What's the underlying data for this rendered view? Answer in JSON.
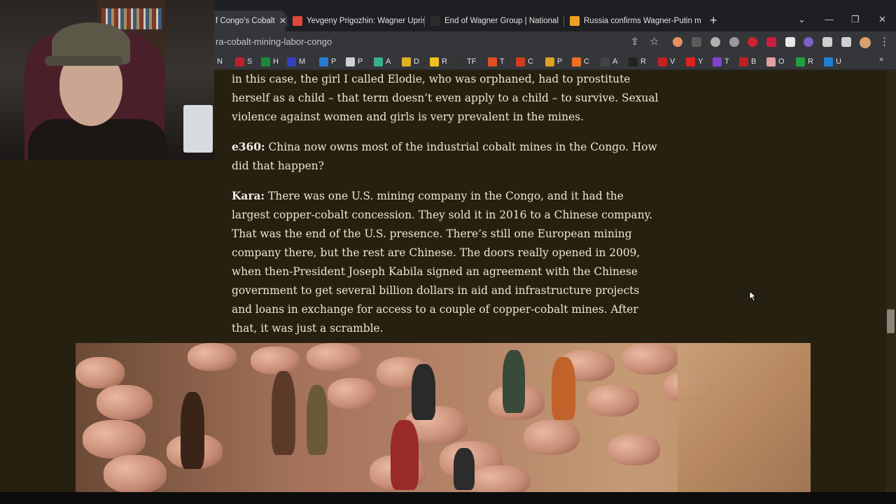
{
  "browser": {
    "tabs": [
      {
        "title": "f Congo's Cobalt",
        "icon_color": "#d45a2a",
        "active": true
      },
      {
        "title": "Yevgeny Prigozhin: Wagner Upris",
        "icon_color": "#e2463a",
        "active": false
      },
      {
        "title": "End of Wagner Group | National",
        "icon_color": "#2b2b2b",
        "active": false
      },
      {
        "title": "Russia confirms Wagner-Putin m",
        "icon_color": "#f0a020",
        "active": false
      }
    ],
    "new_tab_label": "+",
    "window_controls": {
      "minimize": "—",
      "restore": "❐",
      "close": "✕"
    },
    "url": "ra-cobalt-mining-labor-congo",
    "toolbar_icons": [
      "share-icon",
      "star-icon",
      "extension-icons",
      "profile-avatar",
      "menu-icon"
    ],
    "bookmarks": [
      {
        "label": "N",
        "color": "#e0e0e0"
      },
      {
        "label": "S",
        "color": "#c0202a"
      },
      {
        "label": "H",
        "color": "#1a8a3a"
      },
      {
        "label": "M",
        "color": "#3040c0"
      },
      {
        "label": "P",
        "color": "#2a7ad0"
      },
      {
        "label": "P",
        "color": "#d0d0d0"
      },
      {
        "label": "A",
        "color": "#3ab08a"
      },
      {
        "label": "D",
        "color": "#e0b020"
      },
      {
        "label": "R",
        "color": "#f0c020"
      },
      {
        "label": "TF",
        "color": "#333333"
      },
      {
        "label": "T",
        "color": "#e05020"
      },
      {
        "label": "C",
        "color": "#d04020"
      },
      {
        "label": "P",
        "color": "#e0a020"
      },
      {
        "label": "C",
        "color": "#f07020"
      },
      {
        "label": "A",
        "color": "#444444"
      },
      {
        "label": "R",
        "color": "#222222"
      },
      {
        "label": "V",
        "color": "#c02020"
      },
      {
        "label": "Y",
        "color": "#e02020"
      },
      {
        "label": "T",
        "color": "#8040d0"
      },
      {
        "label": "B",
        "color": "#c02020"
      },
      {
        "label": "O",
        "color": "#e0a0a0"
      },
      {
        "label": "R",
        "color": "#20a040"
      },
      {
        "label": "U",
        "color": "#2080d0"
      }
    ],
    "bookmarks_more": "»"
  },
  "article": {
    "p1_text": "in this case, the girl I called Elodie, who was orphaned, had to prostitute herself as a child – that term doesn’t even apply to a child – to survive. Sexual violence against women and girls is very prevalent in the mines.",
    "q_speaker": "e360:",
    "q_text": " China now owns most of the industrial cobalt mines in the Congo. How did that happen?",
    "a_speaker": "Kara:",
    "a_text": " There was one U.S. mining company in the Congo, and it had the largest copper-cobalt concession. They sold it in 2016 to a Chinese company. That was the end of the U.S. presence. There’s still one European mining company there, but the rest are Chinese. The doors really opened in 2009, when then-President Joseph Kabila signed an agreement with the Chinese government to get several billion dollars in aid and infrastructure projects and loans in exchange for access to a couple of copper-cobalt mines. After that, it was just a scramble."
  },
  "colors": {
    "page_bg": "#262010",
    "text": "#ece6d8",
    "chrome_dark": "#1e1f22",
    "chrome": "#35363a"
  }
}
